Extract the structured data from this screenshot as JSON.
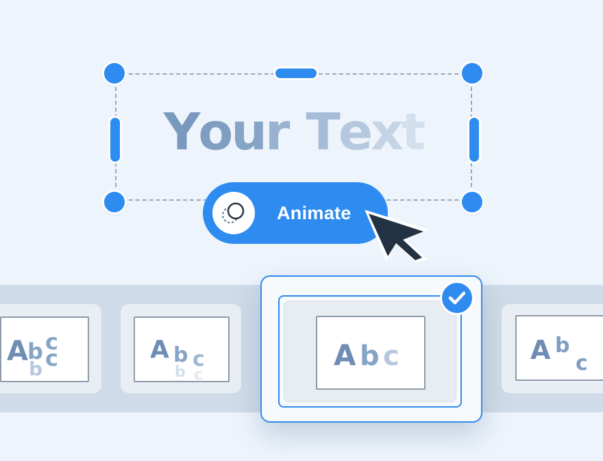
{
  "canvas": {
    "text_box": {
      "text": "Your Text",
      "letters": [
        "Y",
        "o",
        "u",
        "r",
        " ",
        "T",
        "e",
        "x",
        "t"
      ],
      "letter_colors": [
        "#7a99be",
        "#7f9ec2",
        "#86a4c6",
        "#98b2d0",
        "#ffffff",
        "#a7bdd7",
        "#b6c8de",
        "#c4d4e6",
        "#d3dfec"
      ]
    },
    "animate_button": {
      "label": "Animate",
      "icon": "animate-circles-icon"
    }
  },
  "animation_presets": {
    "selected_index": 2,
    "items": [
      {
        "id": "preset-1",
        "label": "Abc",
        "style": "rise"
      },
      {
        "id": "preset-2",
        "label": "Abc",
        "style": "fade-drop"
      },
      {
        "id": "preset-3",
        "label": "Abc",
        "style": "wipe"
      },
      {
        "id": "preset-4",
        "label": "Abc",
        "style": "bounce"
      }
    ],
    "check_icon": "checkmark-icon"
  },
  "colors": {
    "accent": "#2e8bf0",
    "text_slate": "#7f9ec2",
    "background": "#edf4fc",
    "strip": "#cfdbe8",
    "cursor": "#223242"
  }
}
